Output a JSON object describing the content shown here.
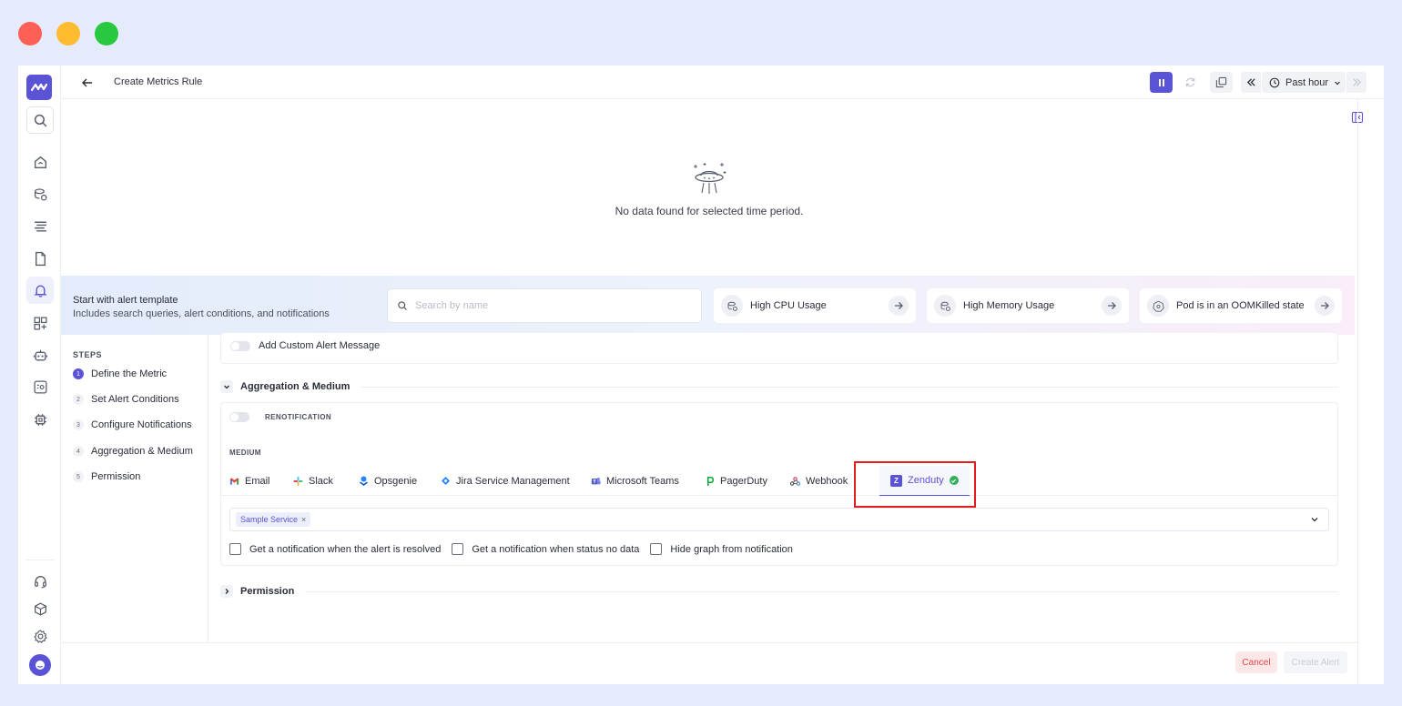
{
  "topbar": {
    "title": "Create Metrics Rule",
    "time_range": "Past hour"
  },
  "empty_state": {
    "message": "No data found for selected time period."
  },
  "template": {
    "title": "Start with alert template",
    "subtitle": "Includes search queries, alert conditions, and notifications",
    "search_placeholder": "Search by name",
    "cards": [
      {
        "label": "High CPU Usage",
        "icon": "cpu-chip-icon"
      },
      {
        "label": "High Memory Usage",
        "icon": "memory-icon"
      },
      {
        "label": "Pod is in an OOMKilled state",
        "icon": "kubernetes-icon"
      }
    ]
  },
  "steps": {
    "heading": "STEPS",
    "items": [
      {
        "num": "1",
        "label": "Define the Metric"
      },
      {
        "num": "2",
        "label": "Set Alert Conditions"
      },
      {
        "num": "3",
        "label": "Configure Notifications"
      },
      {
        "num": "4",
        "label": "Aggregation & Medium"
      },
      {
        "num": "5",
        "label": "Permission"
      }
    ]
  },
  "form": {
    "custom_message_label": "Add Custom Alert Message",
    "aggregation_section": "Aggregation & Medium",
    "renotification_label": "RENOTIFICATION",
    "medium_label": "MEDIUM",
    "mediums": [
      {
        "label": "Email",
        "icon": "gmail-icon"
      },
      {
        "label": "Slack",
        "icon": "slack-icon"
      },
      {
        "label": "Opsgenie",
        "icon": "opsgenie-icon"
      },
      {
        "label": "Jira Service Management",
        "icon": "jira-icon"
      },
      {
        "label": "Microsoft Teams",
        "icon": "teams-icon"
      },
      {
        "label": "PagerDuty",
        "icon": "pagerduty-icon"
      },
      {
        "label": "Webhook",
        "icon": "webhook-icon"
      },
      {
        "label": "Zenduty",
        "icon": "zenduty-icon",
        "selected": true
      }
    ],
    "service_chip": "Sample Service",
    "checkboxes": [
      "Get a notification when the alert is resolved",
      "Get a notification when status no data",
      "Hide graph from notification"
    ],
    "permission_section": "Permission"
  },
  "footer": {
    "cancel": "Cancel",
    "create": "Create Alert"
  },
  "colors": {
    "accent": "#5b53d6",
    "highlight": "#e11d1d",
    "success": "#2fb05a",
    "danger": "#e54848"
  }
}
